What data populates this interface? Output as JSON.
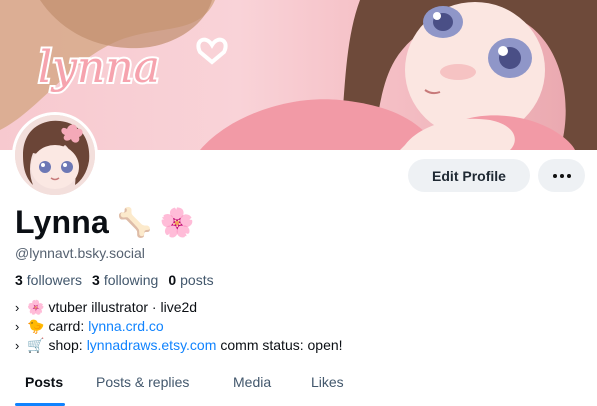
{
  "banner": {
    "logo_text": "lynna"
  },
  "profile": {
    "display_name": "Lynna",
    "handle": "@lynnavt.bsky.social",
    "name_emojis": [
      "🦴",
      "🌸"
    ]
  },
  "actions": {
    "edit_label": "Edit Profile",
    "more_icon": "ellipsis-icon"
  },
  "stats": {
    "followers_count": "3",
    "followers_label": "followers",
    "following_count": "3",
    "following_label": "following",
    "posts_count": "0",
    "posts_label": "posts"
  },
  "bio": {
    "line1": {
      "chevron": "›",
      "emoji": "🌸",
      "text": "vtuber illustrator · live2d"
    },
    "line2": {
      "chevron": "›",
      "emoji": "🐤",
      "prefix": "carrd:",
      "link": "lynna.crd.co"
    },
    "line3": {
      "chevron": "›",
      "emoji": "🛒",
      "prefix": "shop:",
      "link": "lynnadraws.etsy.com",
      "suffix": "comm status: open!"
    }
  },
  "tabs": [
    {
      "label": "Posts",
      "active": true
    },
    {
      "label": "Posts & replies",
      "active": false
    },
    {
      "label": "Media",
      "active": false
    },
    {
      "label": "Likes",
      "active": false
    }
  ],
  "colors": {
    "accent": "#1083fe",
    "button_bg": "#eef1f4",
    "banner_pink": "#f7c9cf"
  }
}
